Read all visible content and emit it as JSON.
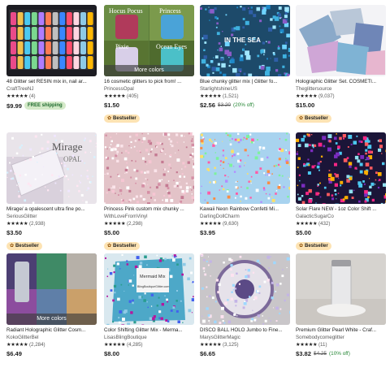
{
  "listings": [
    {
      "title": "48 Glitter set RESIN mix in, nail ar...",
      "shop": "CraftTreeNJ",
      "stars": "★★★★★",
      "reviews": "(4)",
      "price": "$9.99",
      "original_price": "",
      "discount": "",
      "free_shipping": "FREE shipping",
      "bestseller": "",
      "more_colors": "",
      "image_text": []
    },
    {
      "title": "16 cosmetic glitters to pick from! ...",
      "shop": "PrincessOpal",
      "stars": "★★★★★",
      "reviews": "(405)",
      "price": "$1.50",
      "original_price": "",
      "discount": "",
      "free_shipping": "",
      "bestseller": "Bestseller",
      "more_colors": "More colors",
      "image_text": [
        "Hocus Pocus",
        "Princess",
        "Pixie",
        "Ocean Eyes"
      ]
    },
    {
      "title": "Blue chunky glitter mix | Glitter fo...",
      "shop": "StarlightshineUS",
      "stars": "★★★★★",
      "reviews": "(1,521)",
      "price": "$2.56",
      "original_price": "$3.20",
      "discount": "(20% off)",
      "free_shipping": "",
      "bestseller": "",
      "more_colors": "",
      "image_text": [
        "IN THE SEA"
      ]
    },
    {
      "title": "Holographic Glitter Set. COSMETI...",
      "shop": "Theglittersource",
      "stars": "★★★★★",
      "reviews": "(9,037)",
      "price": "$15.00",
      "original_price": "",
      "discount": "",
      "free_shipping": "",
      "bestseller": "Bestseller",
      "more_colors": "",
      "image_text": []
    },
    {
      "title": "Mirage/ a opalescent ultra fine po...",
      "shop": "SeriousGlitter",
      "stars": "★★★★★",
      "reviews": "(2,938)",
      "price": "$3.50",
      "original_price": "",
      "discount": "",
      "free_shipping": "",
      "bestseller": "Bestseller",
      "more_colors": "",
      "image_text": [
        "Mirage",
        "OPAL"
      ]
    },
    {
      "title": "Princess Pink custom mix chunky ...",
      "shop": "WithLoveFromVinyl",
      "stars": "★★★★★",
      "reviews": "(2,298)",
      "price": "$5.00",
      "original_price": "",
      "discount": "",
      "free_shipping": "",
      "bestseller": "Bestseller",
      "more_colors": "",
      "image_text": []
    },
    {
      "title": "Kawaii Neon Rainbow Confetti Mi...",
      "shop": "DarlingDollCharm",
      "stars": "★★★★★",
      "reviews": "(9,630)",
      "price": "$3.95",
      "original_price": "",
      "discount": "",
      "free_shipping": "",
      "bestseller": "",
      "more_colors": "",
      "image_text": []
    },
    {
      "title": "Solar Flare NEW - 1oz Color Shift ...",
      "shop": "GalacticSugarCo",
      "stars": "★★★★★",
      "reviews": "(432)",
      "price": "$5.00",
      "original_price": "",
      "discount": "",
      "free_shipping": "",
      "bestseller": "Bestseller",
      "more_colors": "",
      "image_text": []
    },
    {
      "title": "Radiant Holographic Glitter Cosm...",
      "shop": "KokoGlitterBel",
      "stars": "★★★★★",
      "reviews": "(2,284)",
      "price": "$6.49",
      "original_price": "",
      "discount": "",
      "free_shipping": "",
      "bestseller": "",
      "more_colors": "More colors",
      "image_text": []
    },
    {
      "title": "Color Shifting Glitter Mix - Merma...",
      "shop": "LisasBlingBoutique",
      "stars": "★★★★★",
      "reviews": "(4,285)",
      "price": "$8.00",
      "original_price": "",
      "discount": "",
      "free_shipping": "",
      "bestseller": "",
      "more_colors": "",
      "image_text": [
        "Mermaid Mix",
        "BlingBoutiqueGlitter.com"
      ]
    },
    {
      "title": "DISCO BALL HOLO Jumbo to Fine...",
      "shop": "MarysGlitterMagic",
      "stars": "★★★★★",
      "reviews": "(3,125)",
      "price": "$6.65",
      "original_price": "",
      "discount": "",
      "free_shipping": "",
      "bestseller": "",
      "more_colors": "",
      "image_text": []
    },
    {
      "title": "Premium Glitter Pearl White - Craf...",
      "shop": "Somebodycomeglitter",
      "stars": "★★★★★",
      "reviews": "(11)",
      "price": "$3.82",
      "original_price": "$4.25",
      "discount": "(10% off)",
      "free_shipping": "",
      "bestseller": "",
      "more_colors": "",
      "image_text": []
    }
  ],
  "icons": {
    "bestseller": "bestseller-ribbon-icon",
    "star": "star-icon"
  },
  "colors": {
    "free_shipping_bg": "#d4e9c8",
    "bestseller_bg": "#fde3b3",
    "discount": "#258635"
  }
}
